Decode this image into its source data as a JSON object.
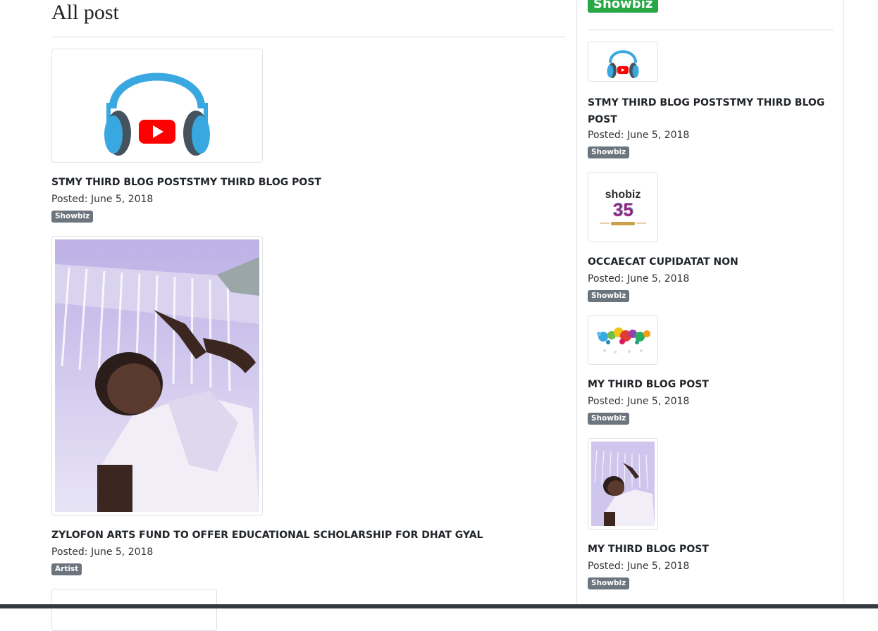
{
  "main": {
    "heading": "All post",
    "posts": [
      {
        "title": "STMY THIRD BLOG POSTSTMY THIRD BLOG POST",
        "date": "Posted: June 5, 2018",
        "category": "Showbiz",
        "image": "headphones-youtube-icon"
      },
      {
        "title": "ZYLOFON ARTS FUND TO OFFER EDUCATIONAL SCHOLARSHIP FOR DHAT GYAL",
        "date": "Posted: June 5, 2018",
        "category": "Artist",
        "image": "person-selfie-photo"
      }
    ]
  },
  "sidebar": {
    "category_heading": "Showbiz",
    "posts": [
      {
        "title": "STMY THIRD BLOG POSTSTMY THIRD BLOG POST",
        "date": "Posted: June 5, 2018",
        "category": "Showbiz",
        "image": "headphones-youtube-icon"
      },
      {
        "title": "OCCAECAT CUPIDATAT NON",
        "date": "Posted: June 5, 2018",
        "category": "Showbiz",
        "image": "shobiz-35-logo",
        "logo_text": "shobiz 35"
      },
      {
        "title": "MY THIRD BLOG POST",
        "date": "Posted: June 5, 2018",
        "category": "Showbiz",
        "image": "paint-splash-image"
      },
      {
        "title": "MY THIRD BLOG POST",
        "date": "Posted: June 5, 2018",
        "category": "Showbiz",
        "image": "person-selfie-photo"
      }
    ]
  },
  "colors": {
    "badge": "#6c757d",
    "category_heading": "#28a745",
    "youtube_red": "#ff0000",
    "headphone_blue": "#3aa8e0"
  }
}
